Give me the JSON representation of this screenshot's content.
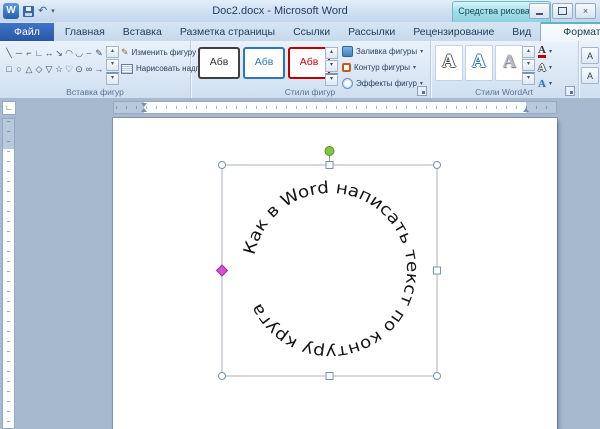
{
  "titlebar": {
    "title": "Doc2.docx - Microsoft Word",
    "contextual_label": "Средства рисования",
    "qat": {
      "logo": "W",
      "undo": "↶",
      "caret": "▾"
    },
    "controls": {
      "close": "×"
    }
  },
  "tabs": {
    "file": "Файл",
    "items": [
      "Главная",
      "Вставка",
      "Разметка страницы",
      "Ссылки",
      "Рассылки",
      "Рецензирование",
      "Вид"
    ],
    "contextual": "Формат"
  },
  "ribbon": {
    "caret": "▾",
    "scroll_up": "▴",
    "scroll_down": "▾",
    "scroll_more": "▾",
    "insert_shapes": {
      "label": "Вставка фигур",
      "row1": [
        "╲",
        "─",
        "⌐",
        "∟",
        "↔",
        "↘",
        "◠",
        "◡",
        "⌣",
        "✎"
      ],
      "row2": [
        "□",
        "○",
        "△",
        "◇",
        "▽",
        "☆",
        "♡",
        "⊙",
        "∞",
        "→"
      ],
      "edit_shape": "Изменить фигуру",
      "draw_textbox": "Нарисовать надпись"
    },
    "shape_styles": {
      "label": "Стили фигур",
      "previews": [
        "Абв",
        "Абв",
        "Абв"
      ],
      "fill": "Заливка фигуры",
      "outline": "Контур фигуры",
      "effects": "Эффекты фигур"
    },
    "wordart_styles": {
      "label": "Стили WordArt",
      "previews": [
        "А",
        "А",
        "А"
      ],
      "text_fill_glyph": "А",
      "text_outline_glyph": "А",
      "text_effects_glyph": "А"
    },
    "cutoff_group": {
      "b1": "А",
      "b2": "А"
    }
  },
  "rulers": {
    "tab_selector": "∟"
  },
  "document": {
    "circular_text": "Как в Word написать текст по контуру круга"
  },
  "colors": {
    "contextual_accent": "#8cd2e1",
    "file_tab": "#2a56a4",
    "preview_border_1": "#404040",
    "preview_border_2": "#2e75b6",
    "preview_border_3": "#c00000",
    "rotation_handle": "#82c341",
    "adjust_handle": "#d254d2"
  }
}
